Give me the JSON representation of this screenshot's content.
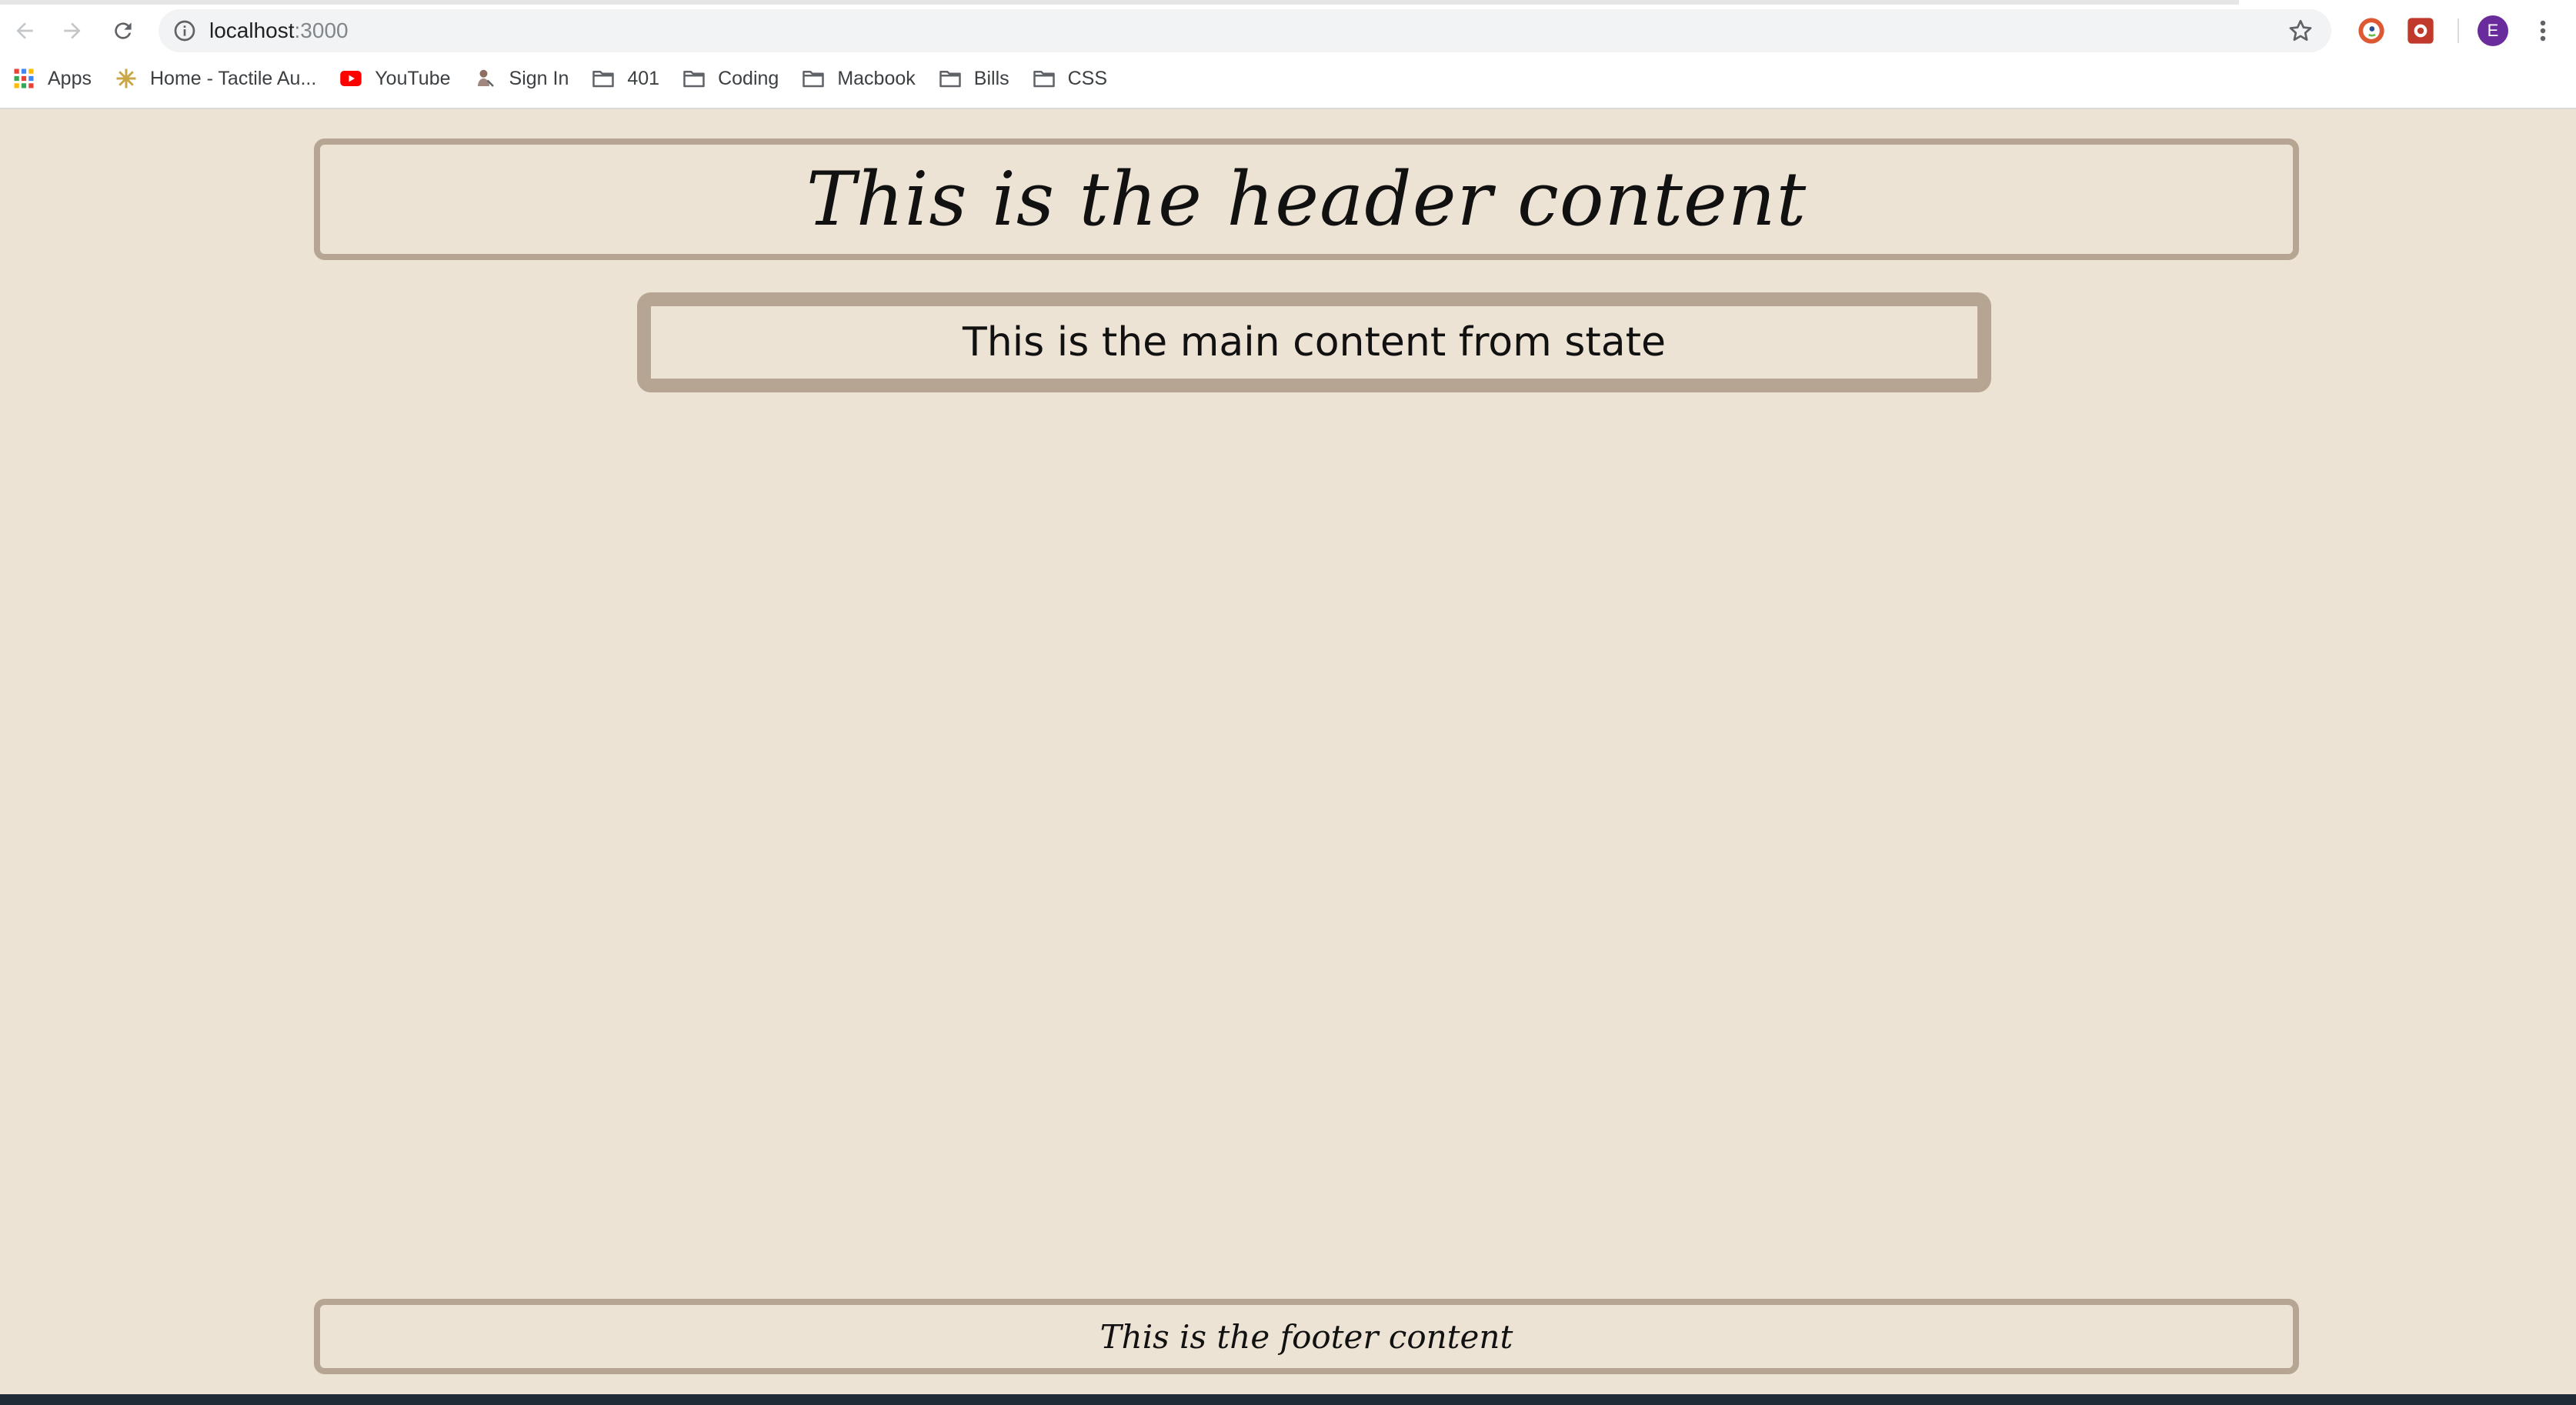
{
  "browser": {
    "url_host": "localhost",
    "url_port": ":3000",
    "bookmarks": [
      {
        "label": "Apps",
        "icon": "apps-grid-icon"
      },
      {
        "label": "Home - Tactile Au...",
        "icon": "site-favicon-icon"
      },
      {
        "label": "YouTube",
        "icon": "youtube-icon"
      },
      {
        "label": "Sign In",
        "icon": "site-favicon-icon"
      },
      {
        "label": "401",
        "icon": "folder-icon"
      },
      {
        "label": "Coding",
        "icon": "folder-icon"
      },
      {
        "label": "Macbook",
        "icon": "folder-icon"
      },
      {
        "label": "Bills",
        "icon": "folder-icon"
      },
      {
        "label": "CSS",
        "icon": "folder-icon"
      }
    ],
    "avatar_initial": "E",
    "avatar_color": "#6a2c9c"
  },
  "page": {
    "header_text": "This is the header content",
    "main_text": "This is the main content from state",
    "footer_text": "This is the footer content",
    "background_color": "#ede3d4",
    "border_color": "#b7a593"
  }
}
